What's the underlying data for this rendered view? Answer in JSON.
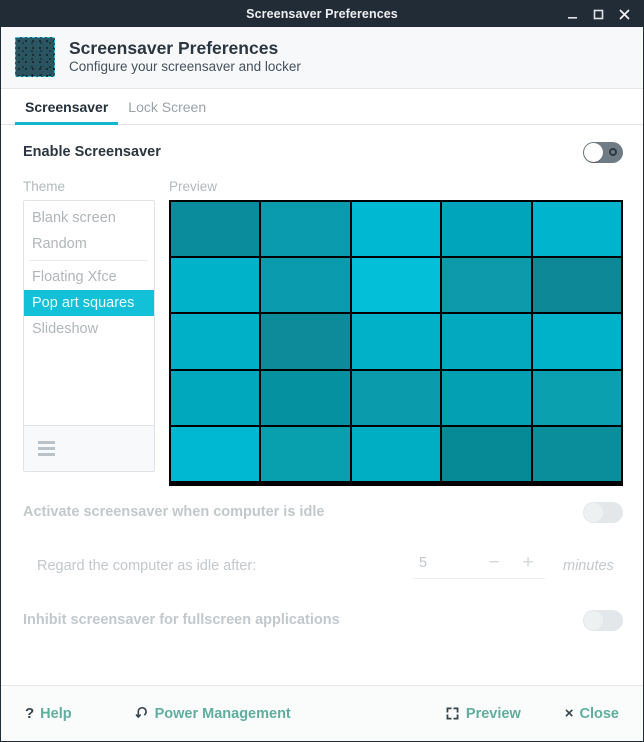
{
  "window": {
    "title": "Screensaver Preferences",
    "controls": [
      {
        "name": "minimize",
        "glyph": "minimize-icon"
      },
      {
        "name": "maximize",
        "glyph": "maximize-icon"
      },
      {
        "name": "close",
        "glyph": "window-close-icon"
      }
    ]
  },
  "header": {
    "icon": "screensaver-app-icon",
    "title": "Screensaver Preferences",
    "subtitle": "Configure your screensaver and locker"
  },
  "tabs": [
    {
      "label": "Screensaver",
      "active": true
    },
    {
      "label": "Lock Screen",
      "active": false
    }
  ],
  "enable_row": {
    "label": "Enable Screensaver",
    "toggle_state": "off",
    "toggle_enabled": true
  },
  "picker": {
    "theme_label": "Theme",
    "preview_label": "Preview",
    "themes": [
      {
        "label": "Blank screen",
        "selected": false,
        "separator_after": false
      },
      {
        "label": "Random",
        "selected": false,
        "separator_after": true
      },
      {
        "label": "Floating Xfce",
        "selected": false,
        "separator_after": false
      },
      {
        "label": "Pop art squares",
        "selected": true,
        "separator_after": false
      },
      {
        "label": "Slideshow",
        "selected": false,
        "separator_after": false
      }
    ],
    "list_menu_icon": "hamburger-menu-icon"
  },
  "preview": {
    "theme": "Pop art squares",
    "background": "#000000",
    "rows": 5,
    "cols": 5,
    "cells": [
      "#0a8c9c",
      "#0a9cae",
      "#00b8d1",
      "#00a5bb",
      "#00b4cd",
      "#00b2c9",
      "#0a9cae",
      "#03c0d8",
      "#0d9aaa",
      "#0c8897",
      "#00b0c7",
      "#0e8b9b",
      "#00b1c8",
      "#03aabf",
      "#00b2c9",
      "#00a8bd",
      "#05919f",
      "#0a9cac",
      "#039fb2",
      "#0aa0b0",
      "#00b8d1",
      "#08a0ae",
      "#00aec4",
      "#068a96",
      "#0a8e9b"
    ]
  },
  "settings": {
    "activate_label": "Activate screensaver when computer is idle",
    "activate_toggle_state": "off",
    "idle_label": "Regard the computer as idle after:",
    "idle_value": "5",
    "decrement": "−",
    "increment": "+",
    "idle_units": "minutes",
    "inhibit_label": "Inhibit screensaver for fullscreen applications",
    "inhibit_toggle_state": "off"
  },
  "footer": {
    "help": {
      "label": "Help",
      "icon": "question-mark-icon",
      "glyph": "?"
    },
    "power": {
      "label": "Power Management",
      "icon": "power-refresh-icon"
    },
    "preview": {
      "label": "Preview",
      "icon": "fullscreen-brackets-icon"
    },
    "close": {
      "label": "Close",
      "icon": "close-x-icon",
      "glyph": "×"
    }
  },
  "colors": {
    "titlebar": "#222c37",
    "accent_tab": "#12b5cb",
    "selection": "#12c0d8",
    "footer_link": "#5fae9f",
    "disabled_text": "#c2c8cc"
  }
}
